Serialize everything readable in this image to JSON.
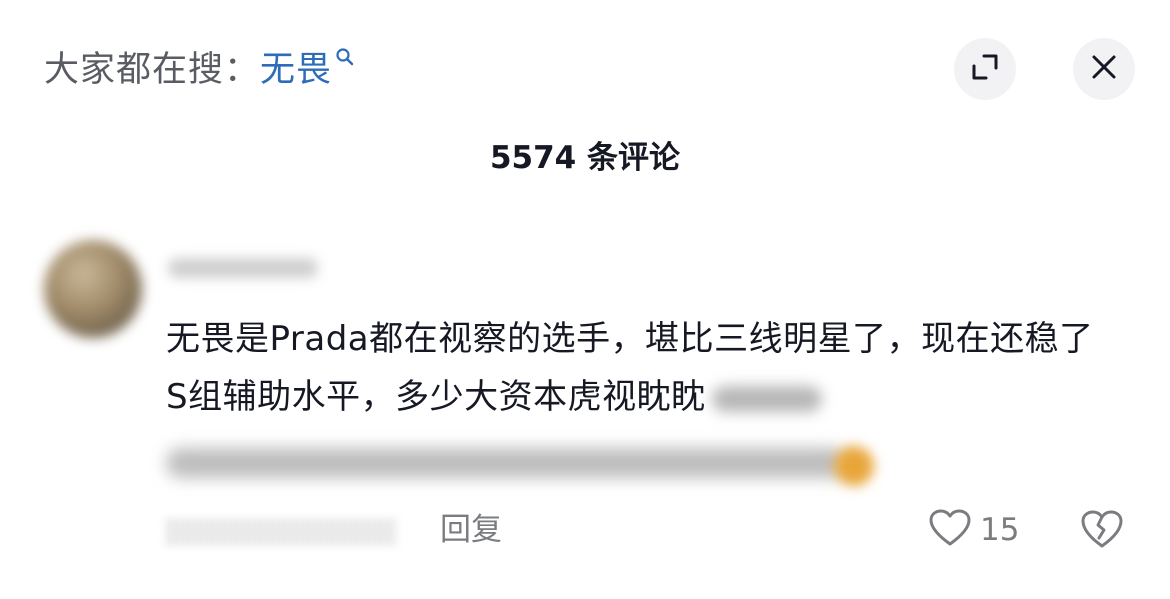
{
  "header": {
    "search_prefix": "大家都在搜：",
    "search_keyword": "无畏",
    "search_icon": "search-icon",
    "expand_icon": "expand-icon",
    "close_icon": "close-icon"
  },
  "comments_header": {
    "count_text": "5574 条评论"
  },
  "comment": {
    "text_visible": "无畏是Prada都在视察的选手，堪比三线明星了，现在还稳了S组辅助水平，多少大资本虎视眈眈",
    "reply_label": "回复",
    "like_count": "15",
    "like_icon": "heart-icon",
    "dislike_icon": "broken-heart-icon"
  },
  "colors": {
    "keyword": "#2e6bb8",
    "text": "#161823",
    "secondary": "#7b7c80",
    "button_bg": "#f2f2f4"
  }
}
